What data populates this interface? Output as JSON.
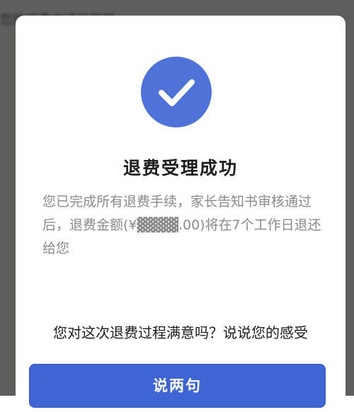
{
  "background": {
    "partial_text": "您的退费申请已受理"
  },
  "dialog": {
    "icon": "check-icon",
    "title": "退费受理成功",
    "message": "您已完成所有退费手续，家长告知书审核通过后，退费金额(¥▓▓▓▓.00)将在7个工作日退还给您",
    "question": "您对这次退费过程满意吗？说说您的感受",
    "button_label": "说两句"
  },
  "colors": {
    "accent": "#4e72d7",
    "button": "#3f64d4",
    "overlay": "#5e5e5a"
  }
}
